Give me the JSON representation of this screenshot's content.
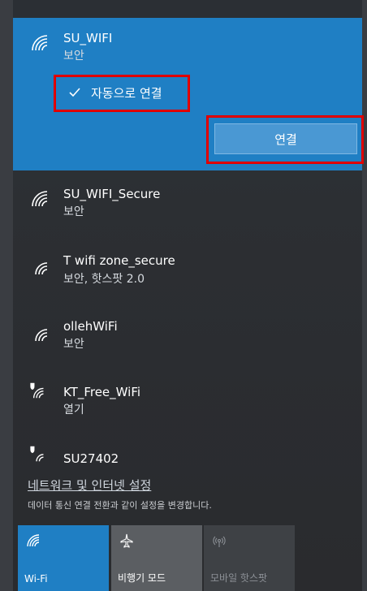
{
  "networks": [
    {
      "name": "SU_WIFI",
      "status": "보안",
      "secured": true,
      "selected": true
    },
    {
      "name": "SU_WIFI_Secure",
      "status": "보안",
      "secured": true
    },
    {
      "name": "T wifi zone_secure",
      "status": "보안, 핫스팟 2.0",
      "secured": true
    },
    {
      "name": "ollehWiFi",
      "status": "보안",
      "secured": true
    },
    {
      "name": "KT_Free_WiFi",
      "status": "열기",
      "secured": false
    },
    {
      "name": "SU27402",
      "status": "",
      "secured": false
    }
  ],
  "selected_network": {
    "auto_connect_label": "자동으로 연결",
    "auto_connect_checked": true,
    "connect_button_label": "연결"
  },
  "settings": {
    "link_label": "네트워크 및 인터넷 설정",
    "description": "데이터 통신 연결 전환과 같이 설정을 변경합니다."
  },
  "quick_actions": [
    {
      "label": "Wi-Fi",
      "icon": "wifi-icon",
      "state": "on"
    },
    {
      "label": "비행기 모드",
      "icon": "airplane-icon",
      "state": "off"
    },
    {
      "label": "모바일 핫스팟",
      "icon": "hotspot-icon",
      "state": "disabled"
    }
  ],
  "colors": {
    "accent": "#1f7fc4",
    "highlight_border": "#e00000",
    "background": "#2b2d31"
  }
}
